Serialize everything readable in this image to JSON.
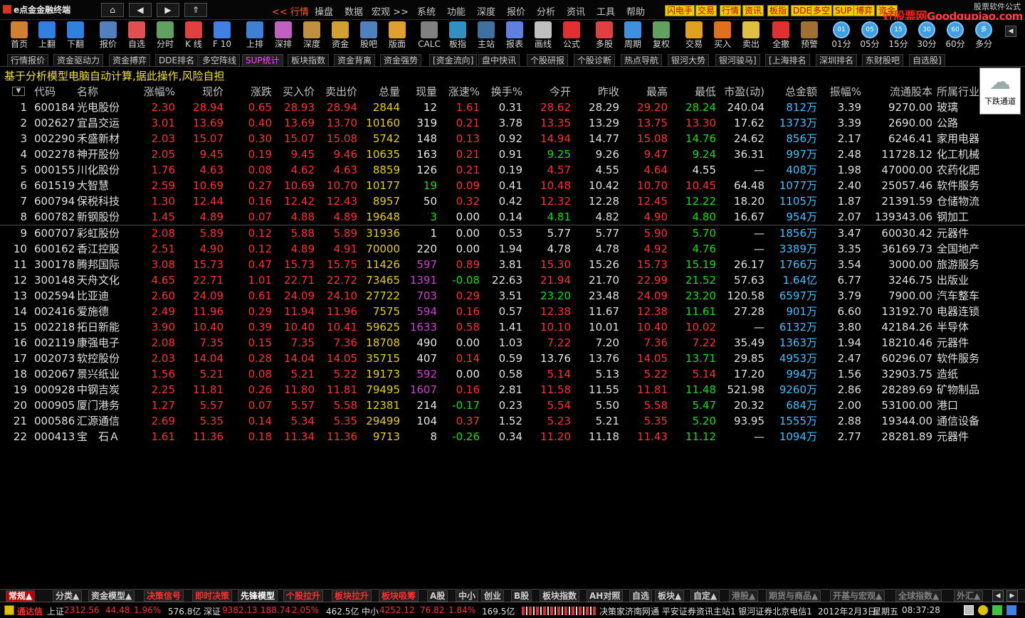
{
  "app": {
    "title": "e点金金融终端"
  },
  "nav": {
    "home": "⌂",
    "back": "◀",
    "forward": "▶",
    "up": "⇑"
  },
  "menu": [
    {
      "label": "<< 行情",
      "active": true
    },
    {
      "label": "操盘"
    },
    {
      "label": "数据"
    },
    {
      "label": "宏观 >>"
    },
    {
      "label": "系统"
    },
    {
      "label": "功能"
    },
    {
      "label": "深度"
    },
    {
      "label": "报价"
    },
    {
      "label": "分析"
    },
    {
      "label": "资讯"
    },
    {
      "label": "工具"
    },
    {
      "label": "帮助"
    }
  ],
  "quick_buttons": [
    "闪电手",
    "交易",
    "行情",
    "资讯",
    "板指",
    "DDE",
    "多空",
    "SUP",
    "博弈",
    "资金"
  ],
  "site_logo": {
    "zh": "好股票网",
    "en": "Goodgupiao.com",
    "sub": "股票软件公式"
  },
  "toolbar": [
    {
      "label": "首页",
      "icon": "home-icon",
      "color": "#d08030"
    },
    {
      "label": "上翻",
      "icon": "arrow-up-icon",
      "color": "#3080e0"
    },
    {
      "label": "下翻",
      "icon": "arrow-down-icon",
      "color": "#3080e0"
    },
    {
      "label": "报价",
      "icon": "price-icon",
      "color": "#5080c0"
    },
    {
      "label": "自选",
      "icon": "favorite-f6-icon",
      "color": "#e05050"
    },
    {
      "label": "分时",
      "icon": "intraday-icon",
      "color": "#60a060"
    },
    {
      "label": "K 线",
      "icon": "kline-icon",
      "color": "#e04040"
    },
    {
      "label": "F 10",
      "icon": "f10-icon",
      "color": "#4080e0"
    },
    {
      "label": "上排",
      "icon": "sh-rank-icon",
      "color": "#4080d0"
    },
    {
      "label": "深排",
      "icon": "sz-rank-icon",
      "color": "#c060c0"
    },
    {
      "label": "深度",
      "icon": "depth-icon",
      "color": "#c09040"
    },
    {
      "label": "资金",
      "icon": "fund-icon",
      "color": "#d0a030"
    },
    {
      "label": "股吧",
      "icon": "forum-icon",
      "color": "#5080c0"
    },
    {
      "label": "版面",
      "icon": "layout-l2-icon",
      "color": "#e0a030"
    },
    {
      "label": "CALC",
      "icon": "calculator-icon",
      "color": "#808080"
    },
    {
      "label": "板指",
      "icon": "sector-index-icon",
      "color": "#3090c0"
    },
    {
      "label": "主站",
      "icon": "server-icon",
      "color": "#4070a0"
    },
    {
      "label": "报表",
      "icon": "report-icon",
      "color": "#6080e0"
    },
    {
      "label": "画线",
      "icon": "draw-line-icon",
      "color": "#c0c0c0"
    },
    {
      "label": "公式",
      "icon": "formula-icon",
      "color": "#e03030"
    },
    {
      "label": "多股",
      "icon": "multi-stock-icon",
      "color": "#e04040"
    },
    {
      "label": "周期",
      "icon": "period-icon",
      "color": "#4090e0"
    },
    {
      "label": "复权",
      "icon": "restore-rights-icon",
      "color": "#60a060"
    },
    {
      "label": "交易",
      "icon": "trade-icon",
      "color": "#e0a020"
    },
    {
      "label": "买入",
      "icon": "buy-icon",
      "color": "#e07020"
    },
    {
      "label": "卖出",
      "icon": "sell-icon",
      "color": "#e0c040"
    },
    {
      "label": "全撤",
      "icon": "cancel-all-icon",
      "color": "#e03030"
    },
    {
      "label": "预警",
      "icon": "alert-icon",
      "color": "#a07030"
    },
    {
      "label": "01分",
      "icon": "1min-icon",
      "circle": "01"
    },
    {
      "label": "05分",
      "icon": "5min-icon",
      "circle": "05"
    },
    {
      "label": "15分",
      "icon": "15min-icon",
      "circle": "15"
    },
    {
      "label": "30分",
      "icon": "30min-icon",
      "circle": "30"
    },
    {
      "label": "60分",
      "icon": "60min-icon",
      "circle": "60"
    },
    {
      "label": "多分",
      "icon": "multi-min-icon",
      "circle": "多"
    }
  ],
  "tabs": [
    {
      "label": "行情报价"
    },
    {
      "label": "资金驱动力"
    },
    {
      "label": "资金搏弈"
    },
    {
      "label": "DDE排名"
    },
    {
      "label": "多空阵线"
    },
    {
      "label": "SUP统计",
      "active": true
    },
    {
      "label": "板块指数"
    },
    {
      "label": "资金背离"
    },
    {
      "label": "资金强势"
    },
    {
      "label": "[资金流向]"
    },
    {
      "label": "盘中快讯"
    },
    {
      "label": "个股研报"
    },
    {
      "label": "个股诊断"
    },
    {
      "label": "热点导航"
    },
    {
      "label": "银河大势"
    },
    {
      "label": "银河骏马]"
    },
    {
      "label": "[上海排名"
    },
    {
      "label": "深圳排名"
    },
    {
      "label": "东财股吧"
    },
    {
      "label": "自选股]"
    }
  ],
  "notice": "基于分析模型电脑自动计算,据此操作,风险自担",
  "weather": {
    "label": "下跌通道"
  },
  "columns": [
    "代码",
    "名称",
    "涨幅%",
    "现价",
    "涨跌",
    "买入价",
    "卖出价",
    "总量",
    "现量",
    "涨速%",
    "换手%",
    "今开",
    "昨收",
    "最高",
    "最低",
    "市盈(动)",
    "总金额",
    "振幅%",
    "流通股本",
    "所属行业"
  ],
  "rows": [
    {
      "no": "1",
      "code": "600184",
      "name": "光电股份",
      "pct": "2.30",
      "price": "28.94",
      "chg": "0.65",
      "bid": "28.93",
      "ask": "28.94",
      "vol": "2844",
      "cur": "12",
      "spd": "1.61",
      "turn": "0.31",
      "open": "28.62",
      "prev": "28.29",
      "high": "29.20",
      "low": "28.24",
      "pe": "240.04",
      "amt": "812万",
      "amp": "3.39",
      "float": "9270.00",
      "ind": "玻璃"
    },
    {
      "no": "2",
      "code": "002627",
      "name": "宜昌交运",
      "pct": "3.01",
      "price": "13.69",
      "chg": "0.40",
      "bid": "13.69",
      "ask": "13.70",
      "vol": "10160",
      "cur": "319",
      "spd": "0.21",
      "turn": "3.78",
      "open": "13.35",
      "prev": "13.29",
      "high": "13.75",
      "low": "13.30",
      "pe": "17.62",
      "amt": "1373万",
      "amp": "3.39",
      "float": "2690.00",
      "ind": "公路"
    },
    {
      "no": "3",
      "code": "002290",
      "name": "禾盛新材",
      "pct": "2.03",
      "price": "15.07",
      "chg": "0.30",
      "bid": "15.07",
      "ask": "15.08",
      "vol": "5742",
      "cur": "148",
      "spd": "0.13",
      "turn": "0.92",
      "open": "14.94",
      "prev": "14.77",
      "high": "15.08",
      "low": "14.76",
      "pe": "24.62",
      "amt": "856万",
      "amp": "2.17",
      "float": "6246.41",
      "ind": "家用电器"
    },
    {
      "no": "4",
      "code": "002278",
      "name": "神开股份",
      "pct": "2.05",
      "price": "9.45",
      "chg": "0.19",
      "bid": "9.45",
      "ask": "9.46",
      "vol": "10635",
      "cur": "163",
      "spd": "0.21",
      "turn": "0.91",
      "open": "9.25",
      "prev": "9.26",
      "high": "9.47",
      "low": "9.24",
      "pe": "36.31",
      "amt": "997万",
      "amp": "2.48",
      "float": "11728.12",
      "ind": "化工机械"
    },
    {
      "no": "5",
      "code": "000155",
      "name": "川化股份",
      "pct": "1.76",
      "price": "4.63",
      "chg": "0.08",
      "bid": "4.62",
      "ask": "4.63",
      "vol": "8859",
      "cur": "126",
      "spd": "0.21",
      "turn": "0.19",
      "open": "4.57",
      "prev": "4.55",
      "high": "4.64",
      "low": "4.55",
      "pe": "—",
      "amt": "408万",
      "amp": "1.98",
      "float": "47000.00",
      "ind": "农药化肥"
    },
    {
      "no": "6",
      "code": "601519",
      "name": "大智慧",
      "pct": "2.59",
      "price": "10.69",
      "chg": "0.27",
      "bid": "10.69",
      "ask": "10.70",
      "vol": "10177",
      "cur": "19",
      "spd": "0.09",
      "turn": "0.41",
      "open": "10.48",
      "prev": "10.42",
      "high": "10.70",
      "low": "10.45",
      "pe": "64.48",
      "amt": "1077万",
      "amp": "2.40",
      "float": "25057.46",
      "ind": "软件服务"
    },
    {
      "no": "7",
      "code": "600794",
      "name": "保税科技",
      "pct": "1.30",
      "price": "12.44",
      "chg": "0.16",
      "bid": "12.42",
      "ask": "12.43",
      "vol": "8957",
      "cur": "50",
      "spd": "0.32",
      "turn": "0.42",
      "open": "12.32",
      "prev": "12.28",
      "high": "12.45",
      "low": "12.22",
      "pe": "18.20",
      "amt": "1105万",
      "amp": "1.87",
      "float": "21391.59",
      "ind": "仓储物流"
    },
    {
      "no": "8",
      "code": "600782",
      "name": "新钢股份",
      "pct": "1.45",
      "price": "4.89",
      "chg": "0.07",
      "bid": "4.88",
      "ask": "4.89",
      "vol": "19648",
      "cur": "3",
      "spd": "0.00",
      "turn": "0.14",
      "open": "4.81",
      "prev": "4.82",
      "high": "4.90",
      "low": "4.80",
      "pe": "16.67",
      "amt": "954万",
      "amp": "2.07",
      "float": "139343.06",
      "ind": "钢加工"
    },
    {
      "no": "9",
      "code": "600707",
      "name": "彩虹股份",
      "pct": "2.08",
      "price": "5.89",
      "chg": "0.12",
      "bid": "5.88",
      "ask": "5.89",
      "vol": "31936",
      "cur": "1",
      "spd": "0.00",
      "turn": "0.53",
      "open": "5.77",
      "prev": "5.77",
      "high": "5.90",
      "low": "5.70",
      "pe": "—",
      "amt": "1856万",
      "amp": "3.47",
      "float": "60030.42",
      "ind": "元器件"
    },
    {
      "no": "10",
      "code": "600162",
      "name": "香江控股",
      "pct": "2.51",
      "price": "4.90",
      "chg": "0.12",
      "bid": "4.89",
      "ask": "4.91",
      "vol": "70000",
      "cur": "220",
      "spd": "0.00",
      "turn": "1.94",
      "open": "4.78",
      "prev": "4.78",
      "high": "4.92",
      "low": "4.76",
      "pe": "—",
      "amt": "3389万",
      "amp": "3.35",
      "float": "36169.73",
      "ind": "全国地产"
    },
    {
      "no": "11",
      "code": "300178",
      "name": "腾邦国际",
      "pct": "3.08",
      "price": "15.73",
      "chg": "0.47",
      "bid": "15.73",
      "ask": "15.75",
      "vol": "11426",
      "cur": "597",
      "spd": "0.89",
      "turn": "3.81",
      "open": "15.30",
      "prev": "15.26",
      "high": "15.73",
      "low": "15.19",
      "pe": "26.17",
      "amt": "1766万",
      "amp": "3.54",
      "float": "3000.00",
      "ind": "旅游服务"
    },
    {
      "no": "12",
      "code": "300148",
      "name": "天舟文化",
      "pct": "4.65",
      "price": "22.71",
      "chg": "1.01",
      "bid": "22.71",
      "ask": "22.72",
      "vol": "73465",
      "cur": "1391",
      "spd": "-0.08",
      "turn": "22.63",
      "open": "21.94",
      "prev": "21.70",
      "high": "22.99",
      "low": "21.52",
      "pe": "57.63",
      "amt": "1.64亿",
      "amp": "6.77",
      "float": "3246.75",
      "ind": "出版业"
    },
    {
      "no": "13",
      "code": "002594",
      "name": "比亚迪",
      "pct": "2.60",
      "price": "24.09",
      "chg": "0.61",
      "bid": "24.09",
      "ask": "24.10",
      "vol": "27722",
      "cur": "703",
      "spd": "0.29",
      "turn": "3.51",
      "open": "23.20",
      "prev": "23.48",
      "high": "24.09",
      "low": "23.20",
      "pe": "120.58",
      "amt": "6597万",
      "amp": "3.79",
      "float": "7900.00",
      "ind": "汽车整车"
    },
    {
      "no": "14",
      "code": "002416",
      "name": "爱施德",
      "pct": "2.49",
      "price": "11.96",
      "chg": "0.29",
      "bid": "11.94",
      "ask": "11.96",
      "vol": "7575",
      "cur": "594",
      "spd": "0.16",
      "turn": "0.57",
      "open": "12.38",
      "prev": "11.67",
      "high": "12.38",
      "low": "11.61",
      "pe": "27.28",
      "amt": "901万",
      "amp": "6.60",
      "float": "13192.70",
      "ind": "电器连锁"
    },
    {
      "no": "15",
      "code": "002218",
      "name": "拓日新能",
      "pct": "3.90",
      "price": "10.40",
      "chg": "0.39",
      "bid": "10.40",
      "ask": "10.41",
      "vol": "59625",
      "cur": "1633",
      "spd": "0.58",
      "turn": "1.41",
      "open": "10.10",
      "prev": "10.01",
      "high": "10.40",
      "low": "10.02",
      "pe": "—",
      "amt": "6132万",
      "amp": "3.80",
      "float": "42184.26",
      "ind": "半导体"
    },
    {
      "no": "16",
      "code": "002119",
      "name": "康强电子",
      "pct": "2.08",
      "price": "7.35",
      "chg": "0.15",
      "bid": "7.35",
      "ask": "7.36",
      "vol": "18708",
      "cur": "490",
      "spd": "0.00",
      "turn": "1.03",
      "open": "7.22",
      "prev": "7.20",
      "high": "7.36",
      "low": "7.22",
      "pe": "35.49",
      "amt": "1363万",
      "amp": "1.94",
      "float": "18210.46",
      "ind": "元器件"
    },
    {
      "no": "17",
      "code": "002073",
      "name": "软控股份",
      "pct": "2.03",
      "price": "14.04",
      "chg": "0.28",
      "bid": "14.04",
      "ask": "14.05",
      "vol": "35715",
      "cur": "407",
      "spd": "0.14",
      "turn": "0.59",
      "open": "13.76",
      "prev": "13.76",
      "high": "14.05",
      "low": "13.71",
      "pe": "29.85",
      "amt": "4953万",
      "amp": "2.47",
      "float": "60296.07",
      "ind": "软件服务"
    },
    {
      "no": "18",
      "code": "002067",
      "name": "景兴纸业",
      "pct": "1.56",
      "price": "5.21",
      "chg": "0.08",
      "bid": "5.21",
      "ask": "5.22",
      "vol": "19173",
      "cur": "592",
      "spd": "0.00",
      "turn": "0.58",
      "open": "5.14",
      "prev": "5.13",
      "high": "5.22",
      "low": "5.14",
      "pe": "17.20",
      "amt": "994万",
      "amp": "1.56",
      "float": "32903.75",
      "ind": "造纸"
    },
    {
      "no": "19",
      "code": "000928",
      "name": "中钢吉炭",
      "pct": "2.25",
      "price": "11.81",
      "chg": "0.26",
      "bid": "11.80",
      "ask": "11.81",
      "vol": "79495",
      "cur": "1607",
      "spd": "0.16",
      "turn": "2.81",
      "open": "11.58",
      "prev": "11.55",
      "high": "11.81",
      "low": "11.48",
      "pe": "521.98",
      "amt": "9260万",
      "amp": "2.86",
      "float": "28289.69",
      "ind": "矿物制品"
    },
    {
      "no": "20",
      "code": "000905",
      "name": "厦门港务",
      "pct": "1.27",
      "price": "5.57",
      "chg": "0.07",
      "bid": "5.57",
      "ask": "5.58",
      "vol": "12381",
      "cur": "214",
      "spd": "-0.17",
      "turn": "0.23",
      "open": "5.54",
      "prev": "5.50",
      "high": "5.58",
      "low": "5.47",
      "pe": "20.32",
      "amt": "684万",
      "amp": "2.00",
      "float": "53100.00",
      "ind": "港口"
    },
    {
      "no": "21",
      "code": "000586",
      "name": "汇源通信",
      "pct": "2.69",
      "price": "5.35",
      "chg": "0.14",
      "bid": "5.34",
      "ask": "5.35",
      "vol": "29499",
      "cur": "104",
      "spd": "0.37",
      "turn": "1.52",
      "open": "5.23",
      "prev": "5.21",
      "high": "5.35",
      "low": "5.20",
      "pe": "93.95",
      "amt": "1555万",
      "amp": "2.88",
      "float": "19344.00",
      "ind": "通信设备"
    },
    {
      "no": "22",
      "code": "000413",
      "name": "宝　石Ａ",
      "pct": "1.61",
      "price": "11.36",
      "chg": "0.18",
      "bid": "11.34",
      "ask": "11.36",
      "vol": "9713",
      "cur": "8",
      "spd": "-0.26",
      "turn": "0.34",
      "open": "11.20",
      "prev": "11.18",
      "high": "11.43",
      "low": "11.12",
      "pe": "—",
      "amt": "1094万",
      "amp": "2.77",
      "float": "28281.89",
      "ind": "元器件"
    }
  ],
  "bottom_tabs": [
    {
      "label": "常规▲",
      "color": "#ffffff",
      "active": true
    },
    {
      "label": "分类▲",
      "color": "#d0d0d0"
    },
    {
      "label": "资金模型▲",
      "color": "#d0d0d0"
    },
    {
      "label": "决策信号",
      "color": "#ff3030"
    },
    {
      "label": "即时决策",
      "color": "#ff3030"
    },
    {
      "label": "先锋模型",
      "color": "#ffffff"
    },
    {
      "label": "个股拉升",
      "color": "#ff3030"
    },
    {
      "label": "板块拉升",
      "color": "#ff3030"
    },
    {
      "label": "板块吸筹",
      "color": "#ff3030"
    },
    {
      "label": "A股",
      "color": "#d0d0d0"
    },
    {
      "label": "中小",
      "color": "#d0d0d0"
    },
    {
      "label": "创业",
      "color": "#d0d0d0"
    },
    {
      "label": "B股",
      "color": "#d0d0d0"
    },
    {
      "label": "板块指数",
      "color": "#d0d0d0"
    },
    {
      "label": "AH对照",
      "color": "#d0d0d0"
    },
    {
      "label": "自选",
      "color": "#d0d0d0"
    },
    {
      "label": "板块▲",
      "color": "#d0d0d0"
    },
    {
      "label": "自定▲",
      "color": "#d0d0d0"
    },
    {
      "label": "港股▲",
      "color": "#808080"
    },
    {
      "label": "期货与商品▲",
      "color": "#808080"
    },
    {
      "label": "开基与宏观▲",
      "color": "#808080"
    },
    {
      "label": "全球指数▲",
      "color": "#808080"
    },
    {
      "label": "外汇▲",
      "color": "#808080"
    }
  ],
  "status": {
    "brand": "通达信",
    "sh_label": "上证",
    "sh_index": "2312.56",
    "sh_chg": "44.48",
    "sh_pct": "1.96%",
    "sh_amt": "576.8亿",
    "sz_label": "深证",
    "sz_index": "9382.13",
    "sz_chg": "188.74",
    "sz_pct": "2.05%",
    "sz_amt": "462.5亿",
    "sme_label": "中小",
    "sme_index": "4252.12",
    "sme_chg": "76.82",
    "sme_pct": "1.84%",
    "sme_amt": "169.5亿",
    "info": "决策家济南网通  平安证券资讯主站1  银河证券北京电信1",
    "date": "2012年2月3日",
    "weekday": "星期五",
    "time": "08:37:28"
  },
  "colors": {
    "up": "#ff3030",
    "down": "#10e010",
    "flat": "#e8e8e8",
    "volume": "#e8d000",
    "amount": "#40c0ff",
    "large_vol": "#d040d0"
  }
}
